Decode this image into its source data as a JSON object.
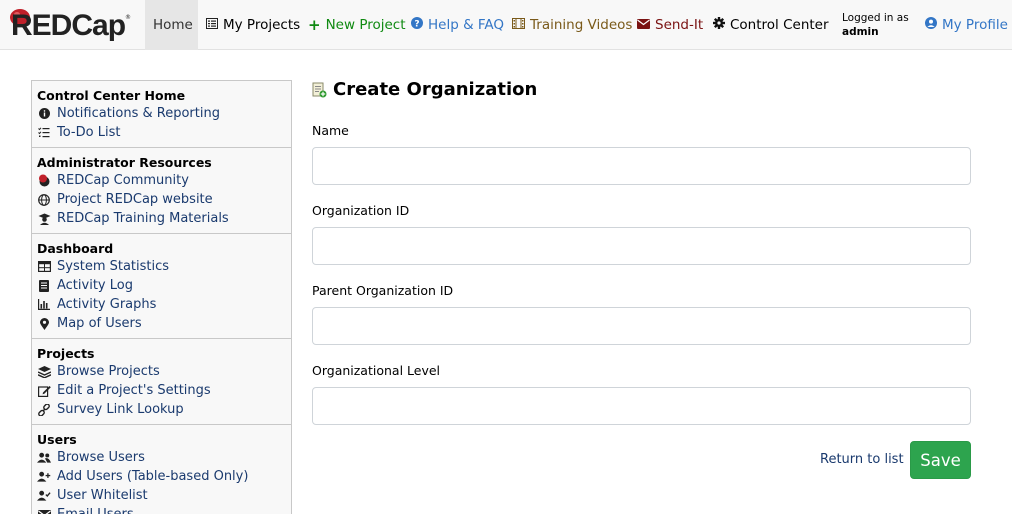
{
  "app": {
    "logo_text": "REDCap",
    "logo_tm": "®"
  },
  "nav": {
    "home": "Home",
    "my_projects": "My Projects",
    "new_project": "New Project",
    "help": "Help & FAQ",
    "training": "Training Videos",
    "sendit": "Send-It",
    "control_center": "Control Center",
    "logged_in_label": "Logged in as",
    "username": "admin",
    "my_profile": "My Profile"
  },
  "colors": {
    "new_project": "#108a12",
    "help": "#3376c6",
    "training": "#7a5a1a",
    "sendit": "#7a1212",
    "link": "#1a3a6e",
    "save": "#2da44e"
  },
  "sidebar": {
    "sections": [
      {
        "title": "Control Center Home",
        "items": [
          {
            "label": "Notifications & Reporting",
            "icon": "info-icon"
          },
          {
            "label": "To-Do List",
            "icon": "checklist-icon"
          }
        ]
      },
      {
        "title": "Administrator Resources",
        "items": [
          {
            "label": "REDCap Community",
            "icon": "community-icon"
          },
          {
            "label": "Project REDCap website",
            "icon": "globe-icon"
          },
          {
            "label": "REDCap Training Materials",
            "icon": "graduate-icon"
          }
        ]
      },
      {
        "title": "Dashboard",
        "items": [
          {
            "label": "System Statistics",
            "icon": "table-icon"
          },
          {
            "label": "Activity Log",
            "icon": "log-icon"
          },
          {
            "label": "Activity Graphs",
            "icon": "chart-icon"
          },
          {
            "label": "Map of Users",
            "icon": "map-marker-icon"
          }
        ]
      },
      {
        "title": "Projects",
        "items": [
          {
            "label": "Browse Projects",
            "icon": "layers-icon"
          },
          {
            "label": "Edit a Project's Settings",
            "icon": "edit-icon"
          },
          {
            "label": "Survey Link Lookup",
            "icon": "link-icon"
          }
        ]
      },
      {
        "title": "Users",
        "items": [
          {
            "label": "Browse Users",
            "icon": "users-icon"
          },
          {
            "label": "Add Users (Table-based Only)",
            "icon": "user-plus-icon"
          },
          {
            "label": "User Whitelist",
            "icon": "user-check-icon"
          },
          {
            "label": "Email Users",
            "icon": "email-icon"
          }
        ]
      }
    ]
  },
  "form": {
    "title": "Create Organization",
    "fields": [
      {
        "label": "Name",
        "value": ""
      },
      {
        "label": "Organization ID",
        "value": ""
      },
      {
        "label": "Parent Organization ID",
        "value": ""
      },
      {
        "label": "Organizational Level",
        "value": ""
      }
    ],
    "return_link": "Return to list",
    "save": "Save"
  }
}
